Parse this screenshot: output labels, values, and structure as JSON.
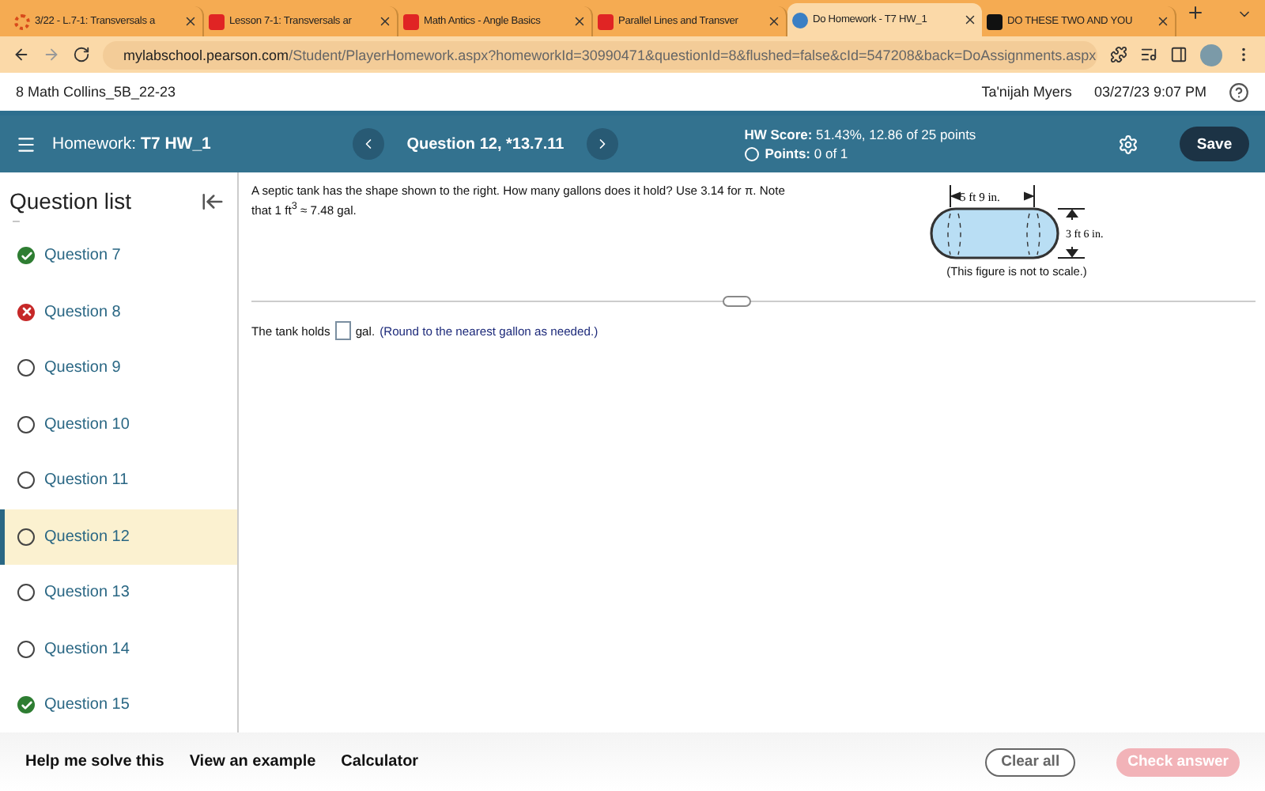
{
  "browser": {
    "tabs": [
      {
        "title": "3/22 - L.7-1: Transversals a",
        "kind": "canvas",
        "selected": false
      },
      {
        "title": "Lesson 7-1: Transversals ar",
        "kind": "video",
        "selected": false
      },
      {
        "title": "Math Antics - Angle Basics",
        "kind": "video",
        "selected": false
      },
      {
        "title": "Parallel Lines and Transver",
        "kind": "video",
        "selected": false
      },
      {
        "title": "Do Homework - T7 HW_1",
        "kind": "pearson",
        "selected": true
      },
      {
        "title": "DO THESE TWO AND YOU",
        "kind": "doc",
        "selected": false
      }
    ],
    "url_host": "mylabschool.pearson.com",
    "url_path": "/Student/PlayerHomework.aspx?homeworkId=30990471&questionId=8&flushed=false&cId=547208&back=DoAssignments.aspx"
  },
  "course": {
    "name": "8 Math Collins_5B_22-23",
    "user": "Ta'nijah Myers",
    "datetime": "03/27/23 9:07 PM"
  },
  "header": {
    "homework": "Homework:",
    "assignment": "T7 HW_1",
    "question": "Question 12, *13.7.11",
    "score": "**HW Score:** 51.43%, 12.86 of 25 points",
    "points": "**Points:** 0 of 1",
    "save": "Save"
  },
  "sidebar": {
    "title": "Question list",
    "fragment": "–",
    "items": [
      {
        "label": "Question 7",
        "kind": "correct",
        "selected": false
      },
      {
        "label": "Question 8",
        "kind": "wrong",
        "selected": false
      },
      {
        "label": "Question 9",
        "kind": "open",
        "selected": false
      },
      {
        "label": "Question 10",
        "kind": "open",
        "selected": false
      },
      {
        "label": "Question 11",
        "kind": "open",
        "selected": false
      },
      {
        "label": "Question 12",
        "kind": "open",
        "selected": true
      },
      {
        "label": "Question 13",
        "kind": "open",
        "selected": false
      },
      {
        "label": "Question 14",
        "kind": "open",
        "selected": false
      },
      {
        "label": "Question 15",
        "kind": "correct",
        "selected": false
      }
    ]
  },
  "question": {
    "text": "A septic tank has the shape shown to the right. How many gallons does it hold? Use 3.14 for π. Note that 1 ft$^{3}$ ≈ 7.48 gal.",
    "figure": {
      "length": "5 ft 9 in.",
      "diameter": "3 ft 6 in.",
      "caption": "(This figure is not to scale.)"
    },
    "answer_prefix": "The tank holds",
    "answer_unit": "gal.",
    "answer_hint": "(Round to the nearest gallon as needed.)"
  },
  "footer": {
    "tools": [
      "Help me solve this",
      "View an example",
      "Calculator"
    ],
    "clear": "Clear all",
    "check": "Check answer",
    "check_disabled": true
  }
}
